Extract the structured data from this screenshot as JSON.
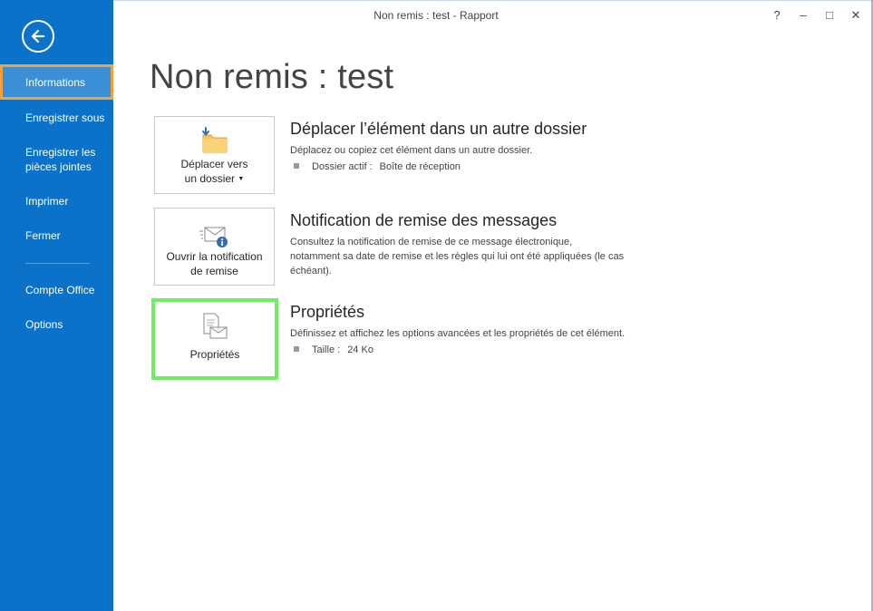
{
  "window": {
    "title": "Non remis : test - Rapport",
    "controls": {
      "help": "?",
      "minimize": "–",
      "maximize": "□",
      "close": "✕"
    }
  },
  "nav": {
    "back_icon": "back-arrow-icon",
    "items": [
      {
        "label": "Informations",
        "active": true
      },
      {
        "label": "Enregistrer sous"
      },
      {
        "label": "Enregistrer les pièces jointes"
      },
      {
        "label": "Imprimer"
      },
      {
        "label": "Fermer"
      },
      {
        "label": "Compte Office"
      },
      {
        "label": "Options"
      }
    ]
  },
  "page": {
    "title": "Non remis : test"
  },
  "sections": {
    "move": {
      "tile_label_1": "Déplacer vers",
      "tile_label_2": "un dossier",
      "tile_icon": "move-to-folder-icon",
      "title": "Déplacer l’élément dans un autre dossier",
      "desc": "Déplacez ou copiez cet élément dans un autre dossier.",
      "prop_label": "Dossier actif :",
      "prop_value": "Boîte de réception"
    },
    "notification": {
      "tile_label_1": "Ouvrir la notification",
      "tile_label_2": "de remise",
      "tile_icon": "delivery-notification-icon",
      "title": "Notification de remise des messages",
      "desc_1": "Consultez la notification de remise de ce message électronique,",
      "desc_2": "notamment sa date de remise et les règles qui lui ont été appliquées (le cas",
      "desc_3": "échéant)."
    },
    "properties": {
      "tile_label": "Propriétés",
      "tile_icon": "properties-icon",
      "title": "Propriétés",
      "desc": "Définissez et affichez les options avancées et les propriétés de cet élément.",
      "prop_label": "Taille :",
      "prop_value": "24 Ko"
    }
  },
  "colors": {
    "nav_bg": "#0a72c8",
    "active_item_bg": "#3b8fd7",
    "active_item_border": "#f5a03d",
    "highlight_border": "#6fee63"
  }
}
